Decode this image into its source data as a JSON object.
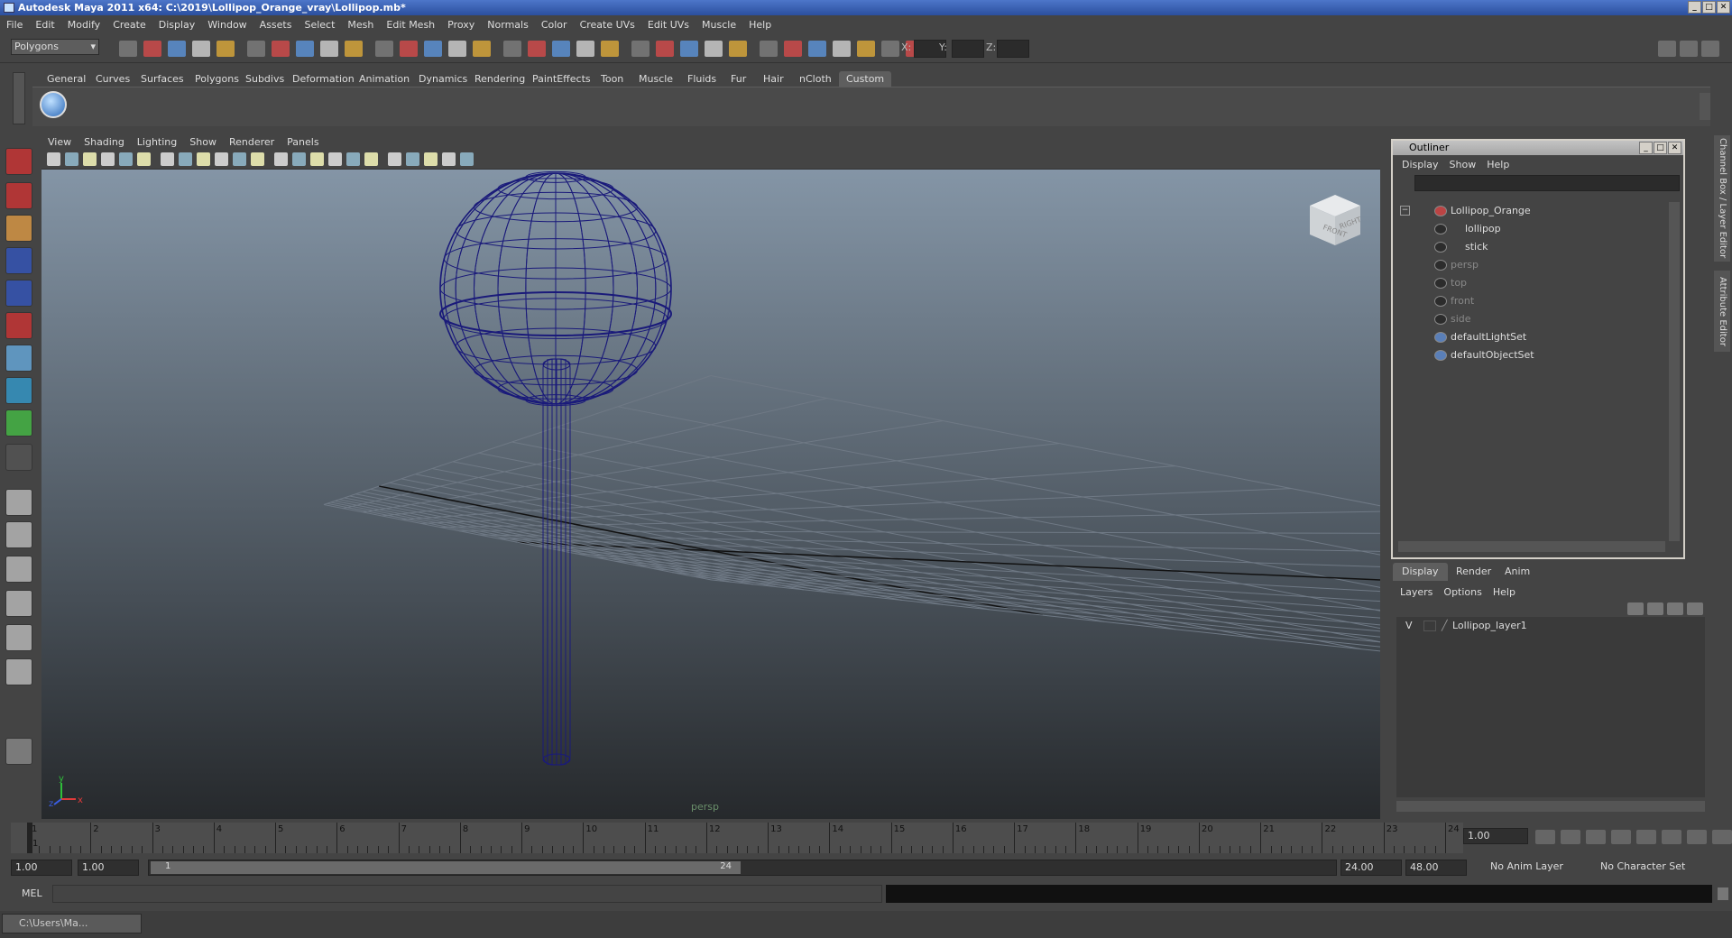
{
  "window": {
    "title": "Autodesk Maya 2011 x64: C:\\2019\\Lollipop_Orange_vray\\Lollipop.mb*"
  },
  "menubar": [
    "File",
    "Edit",
    "Modify",
    "Create",
    "Display",
    "Window",
    "Assets",
    "Select",
    "Mesh",
    "Edit Mesh",
    "Proxy",
    "Normals",
    "Color",
    "Create UVs",
    "Edit UVs",
    "Muscle",
    "Help"
  ],
  "status_line": {
    "mode_selector": "Polygons",
    "x_label": "X:",
    "y_label": "Y:",
    "z_label": "Z:"
  },
  "shelf_tabs": [
    "General",
    "Curves",
    "Surfaces",
    "Polygons",
    "Subdivs",
    "Deformation",
    "Animation",
    "Dynamics",
    "Rendering",
    "PaintEffects",
    "Toon",
    "Muscle",
    "Fluids",
    "Fur",
    "Hair",
    "nCloth",
    "Custom"
  ],
  "shelf_active": "Custom",
  "viewport": {
    "menu": [
      "View",
      "Shading",
      "Lighting",
      "Show",
      "Renderer",
      "Panels"
    ],
    "camera_label": "persp",
    "viewcube_front": "FRONT",
    "viewcube_right": "RIGHT",
    "axis_y": "y",
    "axis_x": "x",
    "axis_z": "z",
    "wire_color": "#1a1a7a"
  },
  "outliner": {
    "title": "Outliner",
    "menu": [
      "Display",
      "Show",
      "Help"
    ],
    "items": [
      {
        "label": "Lollipop_Orange",
        "dim": false
      },
      {
        "label": "lollipop",
        "dim": false
      },
      {
        "label": "stick",
        "dim": false
      },
      {
        "label": "persp",
        "dim": true
      },
      {
        "label": "top",
        "dim": true
      },
      {
        "label": "front",
        "dim": true
      },
      {
        "label": "side",
        "dim": true
      },
      {
        "label": "defaultLightSet",
        "dim": false
      },
      {
        "label": "defaultObjectSet",
        "dim": false
      }
    ]
  },
  "layer_editor": {
    "tabs": [
      "Display",
      "Render",
      "Anim"
    ],
    "menu": [
      "Layers",
      "Options",
      "Help"
    ],
    "layer": {
      "visibility": "V",
      "name": "Lollipop_layer1"
    }
  },
  "side_tabs": [
    "Channel Box / Layer Editor",
    "Attribute Editor"
  ],
  "time_slider": {
    "frames": [
      "1",
      "2",
      "3",
      "4",
      "5",
      "6",
      "7",
      "8",
      "9",
      "10",
      "11",
      "12",
      "13",
      "14",
      "15",
      "16",
      "17",
      "18",
      "19",
      "20",
      "21",
      "22",
      "23",
      "24"
    ],
    "current_frame": "1",
    "current_time": "1.00"
  },
  "range_slider": {
    "start": "1.00",
    "playback_start": "1.00",
    "range_start_label": "1",
    "range_end_label": "24",
    "playback_end": "24.00",
    "end": "48.00",
    "anim_layer": "No Anim Layer",
    "character_set": "No Character Set"
  },
  "command_line": {
    "label": "MEL"
  },
  "taskbar": {
    "item": "C:\\Users\\Ma..."
  }
}
